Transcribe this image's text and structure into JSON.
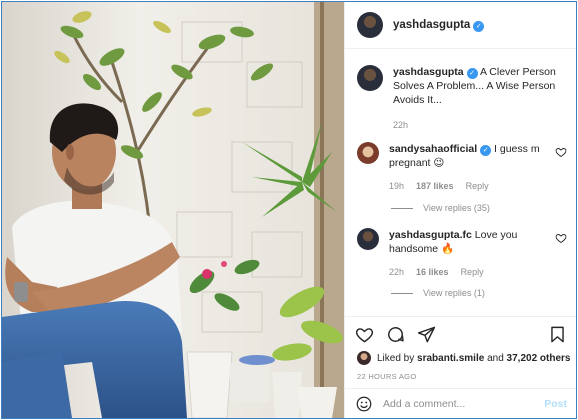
{
  "post": {
    "author": "yashdasgupta",
    "author_verified": true,
    "photo_description_icon": "photo-icon",
    "caption": {
      "author": "yashdasgupta",
      "text": "A Clever Person Solves A Problem... A Wise Person Avoids It...",
      "time": "22h"
    },
    "comments": [
      {
        "author": "sandysahaofficial",
        "verified": true,
        "text": "I guess m pregnant 😉",
        "time": "19h",
        "likes": "187 likes",
        "reply": "Reply",
        "view_replies": "View replies (35)"
      },
      {
        "author": "yashdasgupta.fc",
        "verified": false,
        "text": "Love you handsome 🔥",
        "time": "22h",
        "likes": "16 likes",
        "reply": "Reply",
        "view_replies": "View replies (1)"
      }
    ],
    "liked_by": {
      "prefix": "Liked by",
      "user": "srabanti.smile",
      "conjunction": "and",
      "others": "37,202 others"
    },
    "time_ago": "22 HOURS AGO",
    "add_comment": {
      "placeholder": "Add a comment...",
      "post_label": "Post"
    }
  },
  "colors": {
    "accent": "#3897f0",
    "border": "#3f7fbf",
    "muted": "#8e8e8e",
    "post_disabled": "#b2dffc"
  }
}
